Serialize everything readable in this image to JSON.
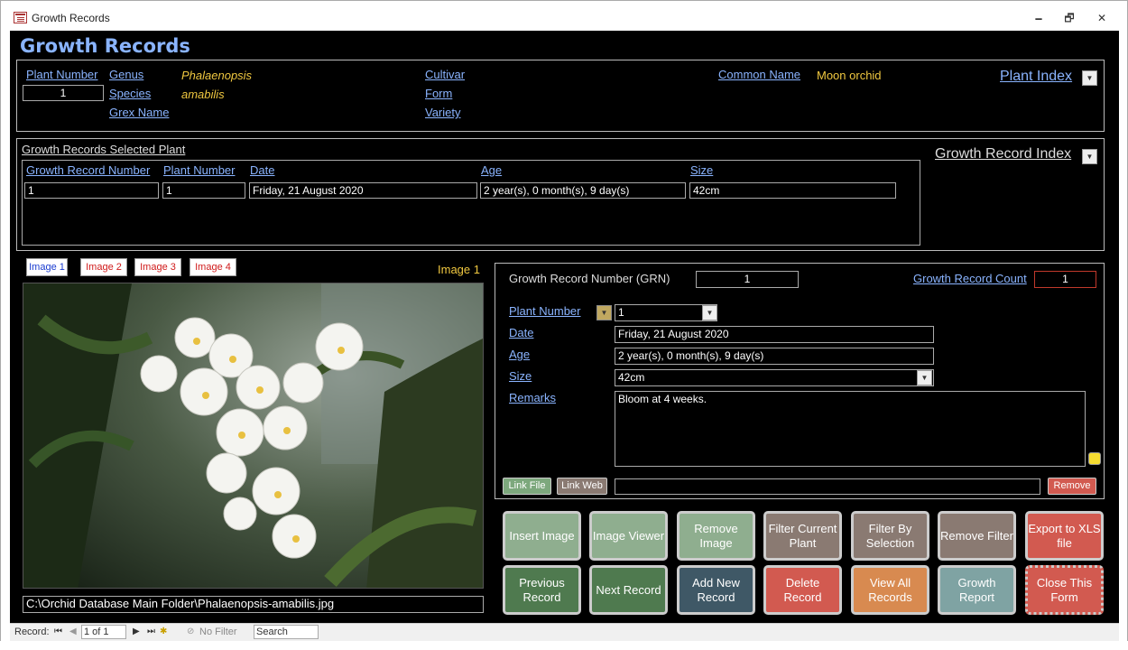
{
  "window": {
    "title": "Growth Records",
    "minimize": "🗕",
    "restore": "🗗",
    "close": "✕"
  },
  "form": {
    "title": "Growth Records"
  },
  "plant": {
    "plant_number_label": "Plant Number",
    "plant_number": "1",
    "genus_label": "Genus",
    "genus": "Phalaenopsis",
    "species_label": "Species",
    "species": "amabilis",
    "grex_label": "Grex Name",
    "cultivar_label": "Cultivar",
    "form_label": "Form",
    "variety_label": "Variety",
    "common_name_label": "Common Name",
    "common_name": "Moon orchid",
    "plant_index_label": "Plant Index"
  },
  "selected": {
    "section_label": "Growth Records Selected Plant",
    "index_label": "Growth Record Index",
    "columns": [
      "Growth Record Number",
      "Plant Number",
      "Date",
      "Age",
      "Size"
    ],
    "row": [
      "1",
      "1",
      "Friday, 21 August 2020",
      "2 year(s), 0 month(s), 9 day(s)",
      "42cm"
    ]
  },
  "images": {
    "tabs": [
      "Image 1",
      "Image 2",
      "Image 3",
      "Image 4"
    ],
    "current_label": "Image 1",
    "path": "C:\\Orchid Database Main Folder\\Phalaenopsis-amabilis.jpg"
  },
  "detail": {
    "grn_label": "Growth Record Number (GRN)",
    "grn": "1",
    "count_label": "Growth Record Count",
    "count": "1",
    "plant_number_label": "Plant Number",
    "plant_number": "1",
    "date_label": "Date",
    "date": "Friday, 21 August 2020",
    "age_label": "Age",
    "age": "2 year(s), 0 month(s), 9 day(s)",
    "size_label": "Size",
    "size": "42cm",
    "remarks_label": "Remarks",
    "remarks": "Bloom at 4 weeks.",
    "link_file": "Link File",
    "link_web": "Link Web",
    "link_value": "",
    "remove": "Remove"
  },
  "buttons": {
    "insert_image": "Insert Image",
    "image_viewer": "Image Viewer",
    "remove_image": "Remove Image",
    "filter_current_plant": "Filter Current Plant",
    "filter_by_selection": "Filter By Selection",
    "remove_filter": "Remove Filter",
    "export_xls": "Export to XLS file",
    "previous_record": "Previous Record",
    "next_record": "Next Record",
    "add_new_record": "Add New Record",
    "delete_record": "Delete Record",
    "view_all_records": "View All Records",
    "growth_report": "Growth Report",
    "close_form": "Close This Form"
  },
  "navigation": {
    "record_label": "Record:",
    "position": "1 of 1",
    "filter_status": "No Filter",
    "search_placeholder": "Search"
  },
  "colors": {
    "link_blue": "#8ab4ff",
    "value_yellow": "#f0c840",
    "green_button": "#8fae8f",
    "dark_green_button": "#4f7a4f",
    "gray_button": "#8a7a72",
    "red_button": "#d25a50",
    "orange_button": "#d88a50",
    "teal_button": "#7fa3a3",
    "navy_button": "#3f5866"
  }
}
